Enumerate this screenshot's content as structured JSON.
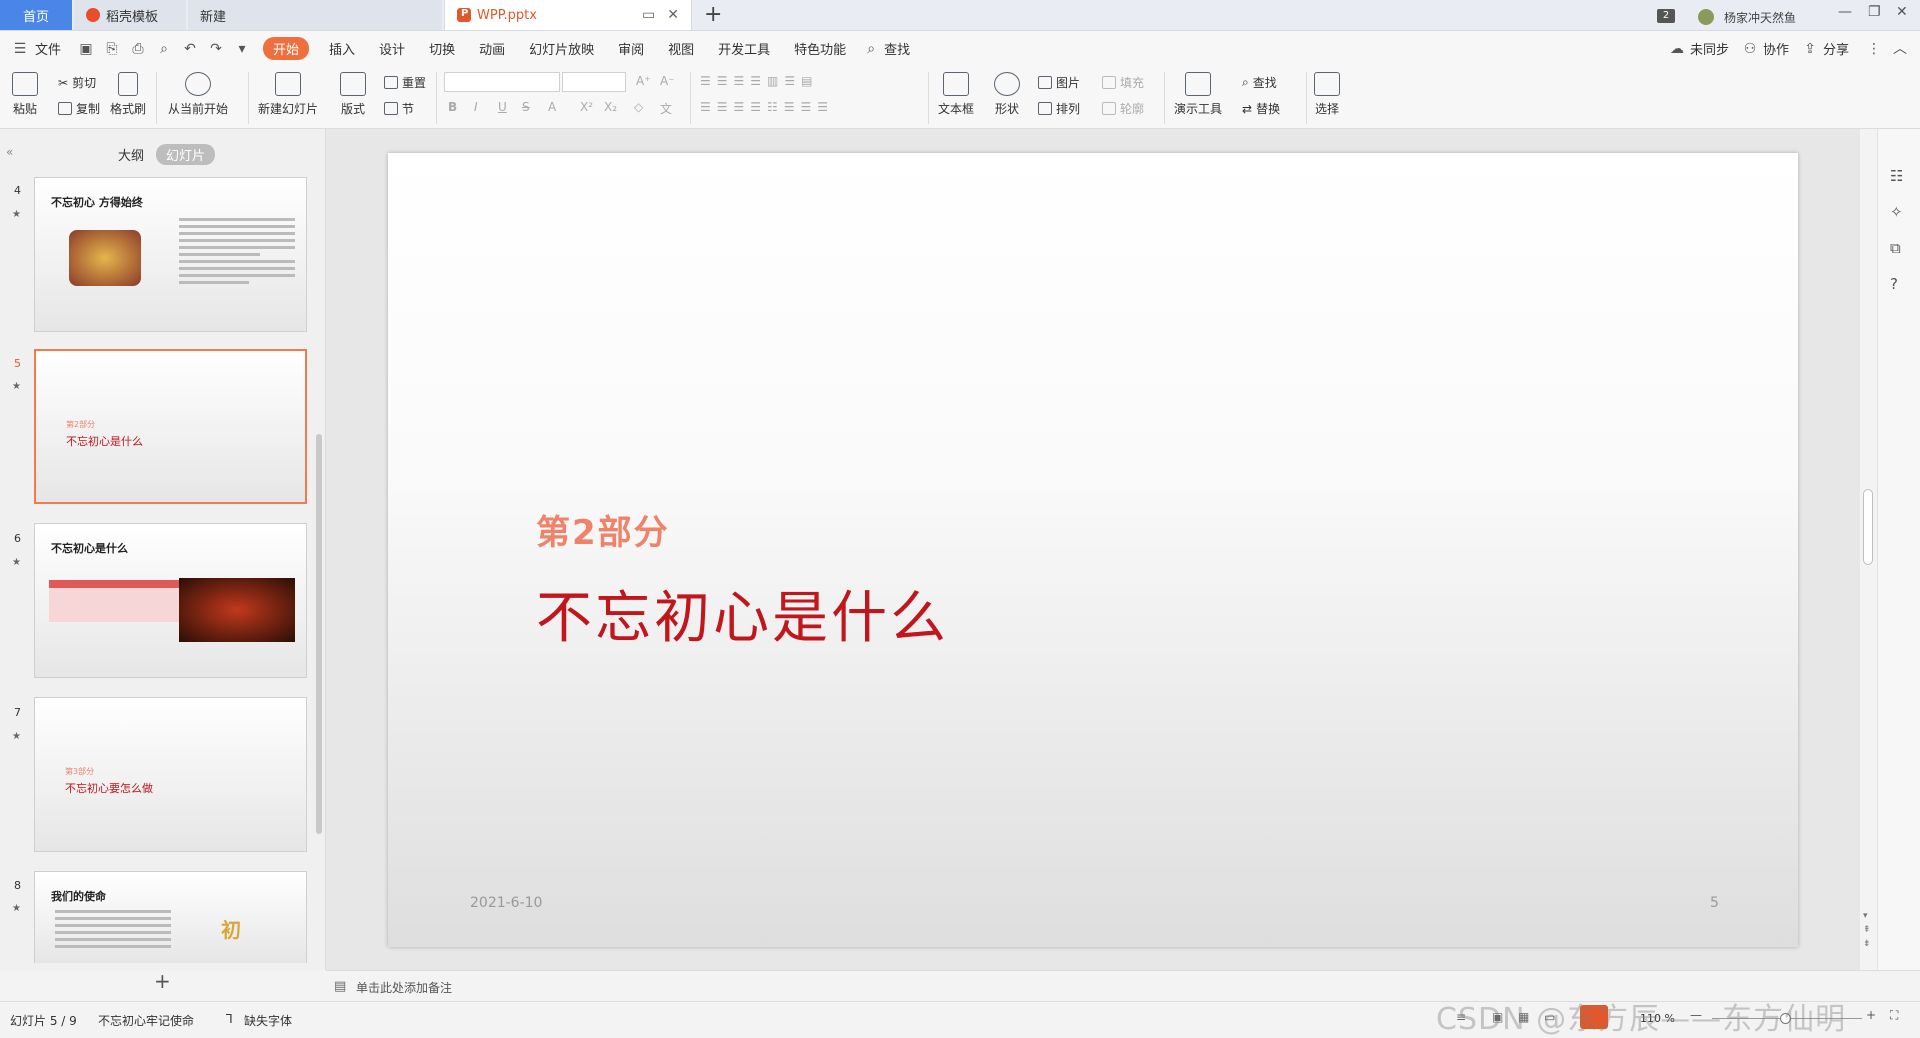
{
  "titlebar": {
    "tabs": {
      "home": "首页",
      "docer": "稻壳模板",
      "new": "新建",
      "doc": "WPP.pptx"
    },
    "new_tab_symbol": "+",
    "user_name": "杨家冲天然鱼",
    "window_count": "2"
  },
  "menu": {
    "file": "文件",
    "items": [
      "开始",
      "插入",
      "设计",
      "切换",
      "动画",
      "幻灯片放映",
      "审阅",
      "视图",
      "开发工具",
      "特色功能"
    ],
    "search": "查找",
    "sync": "未同步",
    "collab": "协作",
    "share": "分享"
  },
  "ribbon": {
    "paste": "粘贴",
    "cut": "剪切",
    "copy": "复制",
    "format_painter": "格式刷",
    "from_current": "从当前开始",
    "new_slide": "新建幻灯片",
    "layout": "版式",
    "reset": "重置",
    "section": "节",
    "textbox": "文本框",
    "shape": "形状",
    "picture": "图片",
    "arrange": "排列",
    "fill": "填充",
    "outline": "轮廓",
    "present_tools": "演示工具",
    "find": "查找",
    "replace": "替换",
    "select": "选择"
  },
  "left_pane": {
    "tab_outline": "大纲",
    "tab_slides": "幻灯片",
    "thumbs": [
      {
        "num": "4",
        "title": "不忘初心 方得始终"
      },
      {
        "num": "5",
        "part": "第2部分",
        "title": "不忘初心是什么"
      },
      {
        "num": "6",
        "title": "不忘初心是什么"
      },
      {
        "num": "7",
        "part": "第3部分",
        "title": "不忘初心要怎么做"
      },
      {
        "num": "8",
        "title": "我们的使命"
      }
    ],
    "add_symbol": "+"
  },
  "slide": {
    "part": "第2部分",
    "title": "不忘初心是什么",
    "date": "2021-6-10",
    "page": "5"
  },
  "notes": {
    "placeholder": "单击此处添加备注"
  },
  "status": {
    "slide_counter": "幻灯片 5 / 9",
    "theme": "不忘初心牢记使命",
    "missing_font": "缺失字体",
    "zoom": "110 %",
    "watermark": "CSDN @东方辰——东方仙明"
  },
  "colors": {
    "accent": "#f06f3f",
    "part_text": "#f0826a",
    "title_red": "#c0161c",
    "home_tab": "#4a86e8"
  }
}
